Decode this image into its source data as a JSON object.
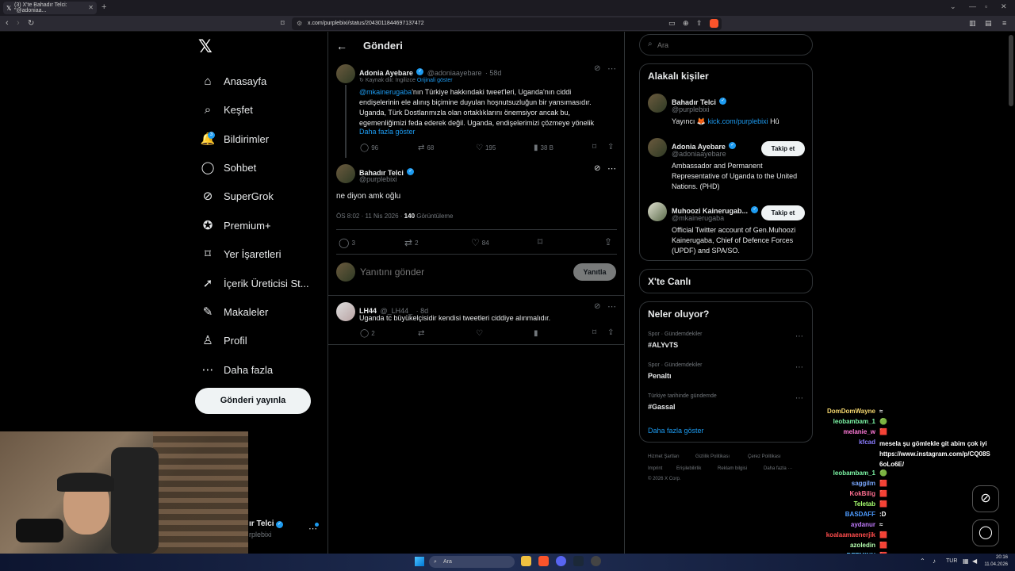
{
  "browser": {
    "tab_title": "(3) X'te Bahadır Telci: \"@adoniaa...",
    "url": "x.com/purplebixi/status/2043011844697137472",
    "new_tab": "+"
  },
  "nav": {
    "items": [
      {
        "label": "Anasayfa",
        "icon": "home-icon",
        "glyph": "⌂"
      },
      {
        "label": "Keşfet",
        "icon": "search-icon",
        "glyph": "⌕"
      },
      {
        "label": "Bildirimler",
        "icon": "bell-icon",
        "glyph": "🔔",
        "badge": "3"
      },
      {
        "label": "Sohbet",
        "icon": "chat-icon",
        "glyph": "◯"
      },
      {
        "label": "SuperGrok",
        "icon": "grok-icon",
        "glyph": "⊘"
      },
      {
        "label": "Premium+",
        "icon": "x-premium-icon",
        "glyph": "✪"
      },
      {
        "label": "Yer İşaretleri",
        "icon": "bookmark-icon",
        "glyph": "⌑"
      },
      {
        "label": "İçerik Üreticisi St...",
        "icon": "rocket-icon",
        "glyph": "➚"
      },
      {
        "label": "Makaleler",
        "icon": "article-icon",
        "glyph": "✎"
      },
      {
        "label": "Profil",
        "icon": "person-icon",
        "glyph": "♙"
      },
      {
        "label": "Daha fazla",
        "icon": "more-circle-icon",
        "glyph": "⋯"
      }
    ],
    "post_button": "Gönderi yayınla",
    "account_name": "ır Telci",
    "account_handle": "rplebixi"
  },
  "header": {
    "title": "Gönderi"
  },
  "quoted_tweet": {
    "name": "Adonia Ayebare",
    "handle": "@adoniaayebare",
    "age": "· 58d",
    "translated_from": "Kaynak dili: İngilizce",
    "show_original": "Orijinali göster",
    "mention": "@mkainerugaba",
    "text": "'nın Türkiye hakkındaki tweet'leri, Uganda'nın ciddi endişelerinin ele alınış biçimine duyulan hoşnutsuzluğun bir yansımasıdır. Uganda, Türk Dostlarımızla olan ortaklıklarını önemsiyor ancak bu, egemenliğimizi feda ederek değil. Uganda, endişelerimizi çözmeye yönelik",
    "show_more": "Daha fazla göster",
    "replies": "96",
    "retweets": "68",
    "likes": "195",
    "views": "38 B"
  },
  "main_tweet": {
    "name": "Bahadır Telci",
    "handle": "@purplebixi",
    "text": "ne diyon amk oğlu",
    "time": "ÖS 8:02 · 11 Nis 2026 · ",
    "views_count": "140",
    "views_label": " Görüntüleme",
    "replies": "3",
    "retweets": "2",
    "likes": "84"
  },
  "reply_box": {
    "placeholder": "Yanıtını gönder",
    "button": "Yanıtla"
  },
  "reply": {
    "name": "LH44",
    "handle": "@_LH44_",
    "age": "· 8d",
    "text": "Uganda tc büyükelçisidir kendisi tweetleri ciddiye alınmalıdır.",
    "replies": "2"
  },
  "sidebar": {
    "search_placeholder": "Ara",
    "related_title": "Alakalı kişiler",
    "people": [
      {
        "name": "Bahadır Telci",
        "handle": "@purplebixi",
        "bio_prefix": "Yayıncı 🦊 ",
        "bio_link": "kick.com/purplebixi",
        "bio_suffix": " Hû"
      },
      {
        "name": "Adonia Ayebare",
        "handle": "@adoniaayebare",
        "bio": "Ambassador and Permanent Representative of Uganda to the United Nations. (PHD)",
        "follow": "Takip et"
      },
      {
        "name": "Muhoozi Kainerugab...",
        "handle": "@mkainerugaba",
        "bio": "Official Twitter account of Gen.Muhoozi Kainerugaba, Chief of Defence Forces (UPDF) and SPA/SO.",
        "follow": "Takip et"
      }
    ],
    "live_title": "X'te Canlı",
    "trends_title": "Neler oluyor?",
    "trends": [
      {
        "context": "Spor · Gündemdekiler",
        "topic": "#ALYvTS"
      },
      {
        "context": "Spor · Gündemdekiler",
        "topic": "Penaltı"
      },
      {
        "context": "Türkiye tarihinde gündemde",
        "topic": "#Gassal"
      }
    ],
    "show_more": "Daha fazla göster",
    "footer": [
      "Hizmet Şartları",
      "Gizlilik Politikası",
      "Çerez Politikası",
      "Imprint",
      "Erişilebilirlik",
      "Reklam bilgisi",
      "Daha fazla ···"
    ],
    "copyright": "© 2026 X Corp."
  },
  "chat": [
    {
      "user": "DomDomWayne",
      "color": "#f5d76e",
      "msg": "≈"
    },
    {
      "user": "leobambam_1",
      "color": "#7cf5a5",
      "msg": "🟢"
    },
    {
      "user": "melanie_w",
      "color": "#ff7ad9",
      "msg": "🟥"
    },
    {
      "user": "kfcad",
      "color": "#8a7cff",
      "msg": "mesela şu gömlekle git abim çok iyi https://www.instagram.com/p/CQ08S 6oLo6E/"
    },
    {
      "user": "leobambam_1",
      "color": "#7cf5a5",
      "msg": "🟢"
    },
    {
      "user": "saggilm",
      "color": "#7aa8ff",
      "msg": "🟥"
    },
    {
      "user": "KokBilig",
      "color": "#ff6f91",
      "msg": "🟥"
    },
    {
      "user": "Teletab",
      "color": "#a8ff6f",
      "msg": "🟥"
    },
    {
      "user": "BASDAFF",
      "color": "#4d9bff",
      "msg": ":D"
    },
    {
      "user": "aydanur",
      "color": "#c27cff",
      "msg": "≈"
    },
    {
      "user": "koalaamaenerjik",
      "color": "#ff4d4d",
      "msg": "🟥"
    },
    {
      "user": "azoledin",
      "color": "#b6ffb0",
      "msg": "🟥"
    },
    {
      "user": "BETMINN",
      "color": "#5ec8ff",
      "msg": "🟥"
    }
  ],
  "taskbar": {
    "search": "Ara",
    "lang": "TUR",
    "time": "20:16",
    "date": "11.04.2026"
  }
}
